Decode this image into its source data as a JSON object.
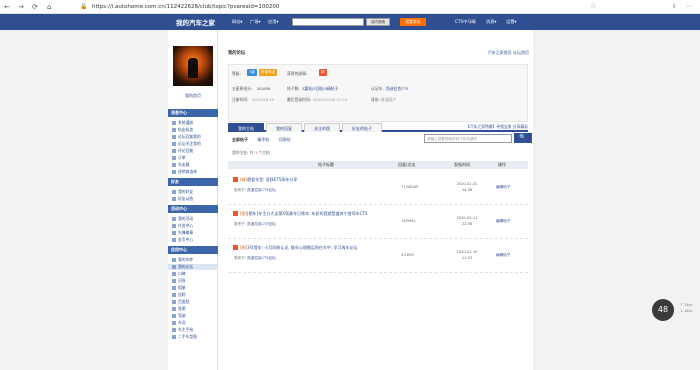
{
  "browser": {
    "back_icon": "←",
    "forward_icon": "→",
    "reload_icon": "⟳",
    "home_icon": "⌂",
    "lock_icon": "🔒",
    "url": "https://i.autohome.com.cn/112422628/club/topic?pvareaid=100200",
    "star_icon": "☆",
    "right_icons": [
      "⇩",
      "⋯"
    ]
  },
  "topbar": {
    "logo": "我的汽车之家",
    "menu": [
      "网站▾",
      "广场▾",
      "应用▾"
    ],
    "search_button": "站内搜索",
    "publish_button": "我要发帖",
    "user": "CTS中马晴",
    "messages": "消息▾",
    "settings": "设置▾"
  },
  "sidebar": {
    "username": "我的首页",
    "sections": [
      {
        "title": "消息中心",
        "items": [
          "系统通知",
          "帖友私信",
          "论坛回复我的",
          "论坛关注我的",
          "评论回复",
          "订单",
          "车友圈",
          "经销商咨询"
        ]
      },
      {
        "title": "好友",
        "items": [
          "我的好友",
          "好友动态"
        ]
      },
      {
        "title": "活动中心",
        "items": [
          "我的活动",
          "任务中心",
          "先锋徽章",
          "金币中心"
        ]
      },
      {
        "title": "应用中心",
        "items": [
          "我的车库",
          "我的论坛",
          "口碑",
          "问答",
          "相册",
          "追踪",
          "百度贴",
          "答案",
          "驾驶",
          "车问",
          "车主手册",
          "二手车型图"
        ]
      }
    ],
    "active_item": "我的论坛"
  },
  "main": {
    "heading": "我的论坛",
    "header_links": "汽车之家首页  论坛首页",
    "info": {
      "level_label": "等级:",
      "level_badge": "7级",
      "level_name": "资深车迷",
      "medal_label": "获得的勋章:",
      "medal_badge": "精",
      "jingyan_label": "五星原创分:",
      "jingyan_value": "20,000",
      "posts_label": "帖子数:",
      "posts_value": "3篇帖/5回帖/0精帖子",
      "cert_label": "认证车:",
      "cert_value": "凯迪拉克CT5",
      "reg_label": "注册时间:",
      "reg_value": "2019-08-15",
      "last_label": "最后登录时间:",
      "last_value": "2020-03-08 21:53",
      "role_label": "身份:",
      "role_value": "普通用户"
    },
    "tabs": [
      "我的主帖",
      "我的回复",
      "关注的版",
      "好友的帖子"
    ],
    "tabs_right": "【汽车之家特邀】寻找宝贵   分享精彩",
    "subtabs": [
      "全部帖子",
      "精华帖",
      "问答帖"
    ],
    "search_placeholder": "请输入您要搜索的帖子的关键字",
    "search_icon": "🔍",
    "count_prefix": "我的主帖: 共",
    "count_value": "3",
    "count_suffix": "个主帖",
    "columns": [
      "帖子标题",
      "回复/点击",
      "发帖时间",
      "操作"
    ],
    "rows": [
      {
        "title_tag": "[精]",
        "title": "晒爱车型: 凌跃ET5周年分享",
        "meta_prefix": "发布于:",
        "meta_forum": "凯迪拉克CT5论坛",
        "count": "71/58089",
        "date": "2020-02-02",
        "time": "14:36",
        "action": "编辑帖子"
      },
      {
        "title_tag": "[图]",
        "title": "[晒车]车主分大证第X驾驶车日常车: 年轮的我就是盛苏宁首驾车CT5",
        "meta_prefix": "发布于:",
        "meta_forum": "凯迪拉克CT5论坛",
        "count": "13/9941",
        "date": "2020-01-11",
        "time": "22:06",
        "action": "编辑帖子"
      },
      {
        "title_tag": "[图]",
        "title": "3号提车: 小月同修认证, 换车心理搬运到在车中; 学习周车论坛",
        "meta_prefix": "发布于:",
        "meta_forum": "凯迪拉克CT5论坛",
        "count": "4/1895",
        "date": "2020-01-10",
        "time": "11:23",
        "action": "编辑帖子"
      }
    ]
  },
  "float": {
    "value": "48",
    "pct1": "↑ 2k/s",
    "pct2": "↓ 4k/s"
  },
  "colors": {
    "brand": "#2f4f92",
    "accent": "#ff6d00"
  }
}
